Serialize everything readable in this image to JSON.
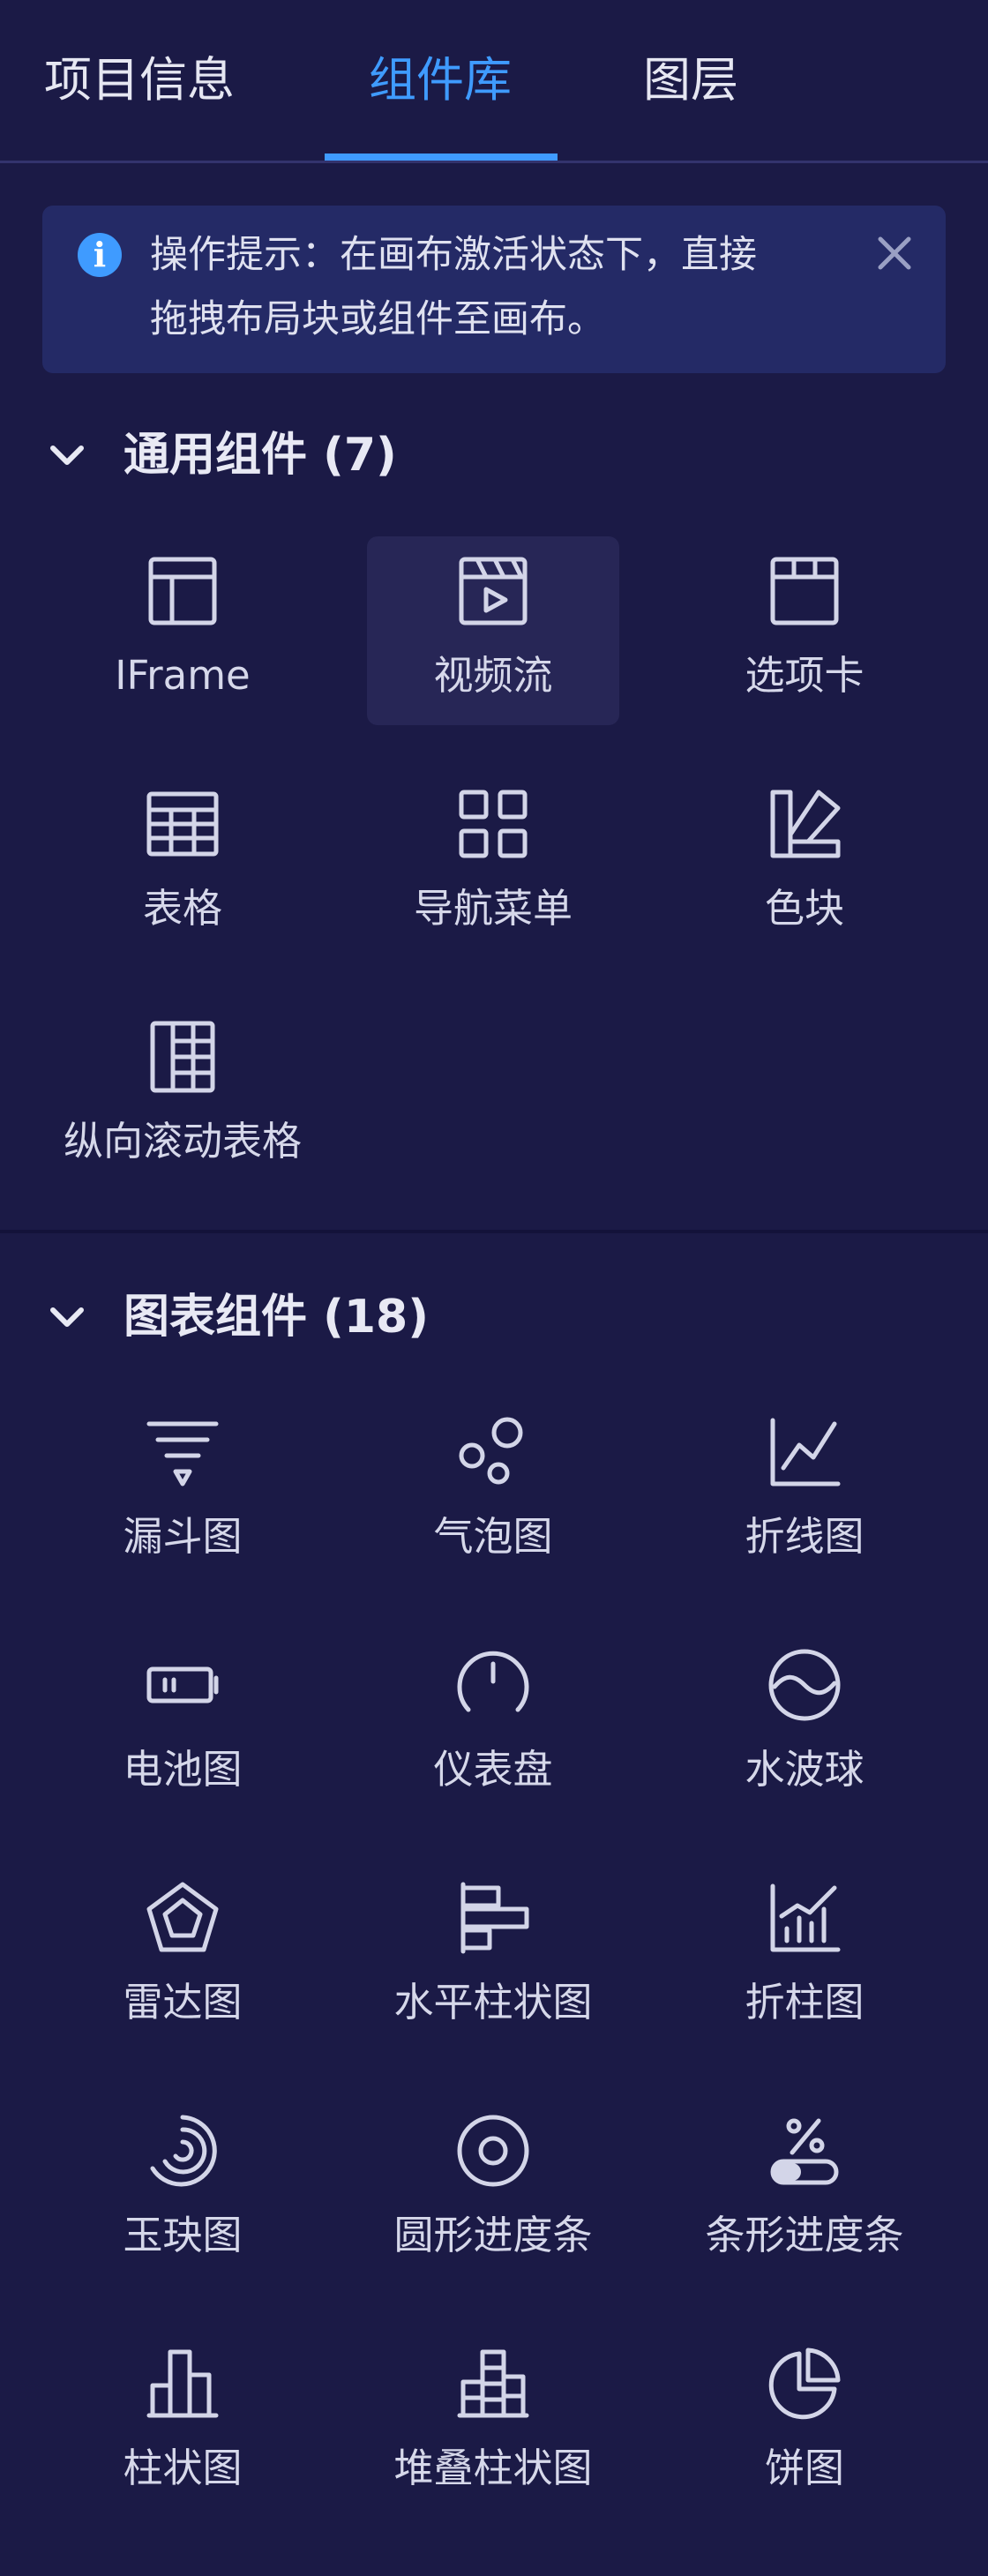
{
  "tabs": [
    {
      "label": "项目信息"
    },
    {
      "label": "组件库"
    },
    {
      "label": "图层"
    }
  ],
  "tip": {
    "line1": "操作提示：在画布激活状态下，直接",
    "line2": "拖拽布局块或组件至画布。"
  },
  "sections": [
    {
      "title": "通用组件 (7)",
      "items": [
        {
          "label": "IFrame",
          "icon": "iframe-icon"
        },
        {
          "label": "视频流",
          "icon": "video-icon"
        },
        {
          "label": "选项卡",
          "icon": "tabs-icon"
        },
        {
          "label": "表格",
          "icon": "table-icon"
        },
        {
          "label": "导航菜单",
          "icon": "nav-menu-icon"
        },
        {
          "label": "色块",
          "icon": "color-block-icon"
        },
        {
          "label": "纵向滚动表格",
          "icon": "scroll-table-icon"
        }
      ]
    },
    {
      "title": "图表组件 (18)",
      "items": [
        {
          "label": "漏斗图",
          "icon": "funnel-icon"
        },
        {
          "label": "气泡图",
          "icon": "bubble-icon"
        },
        {
          "label": "折线图",
          "icon": "line-chart-icon"
        },
        {
          "label": "电池图",
          "icon": "battery-icon"
        },
        {
          "label": "仪表盘",
          "icon": "gauge-icon"
        },
        {
          "label": "水波球",
          "icon": "water-ball-icon"
        },
        {
          "label": "雷达图",
          "icon": "radar-icon"
        },
        {
          "label": "水平柱状图",
          "icon": "horizontal-bar-icon"
        },
        {
          "label": "折柱图",
          "icon": "line-bar-icon"
        },
        {
          "label": "玉玦图",
          "icon": "radial-bar-icon"
        },
        {
          "label": "圆形进度条",
          "icon": "circle-progress-icon"
        },
        {
          "label": "条形进度条",
          "icon": "bar-progress-icon"
        },
        {
          "label": "柱状图",
          "icon": "bar-chart-icon"
        },
        {
          "label": "堆叠柱状图",
          "icon": "stacked-bar-icon"
        },
        {
          "label": "饼图",
          "icon": "pie-icon"
        }
      ]
    }
  ]
}
